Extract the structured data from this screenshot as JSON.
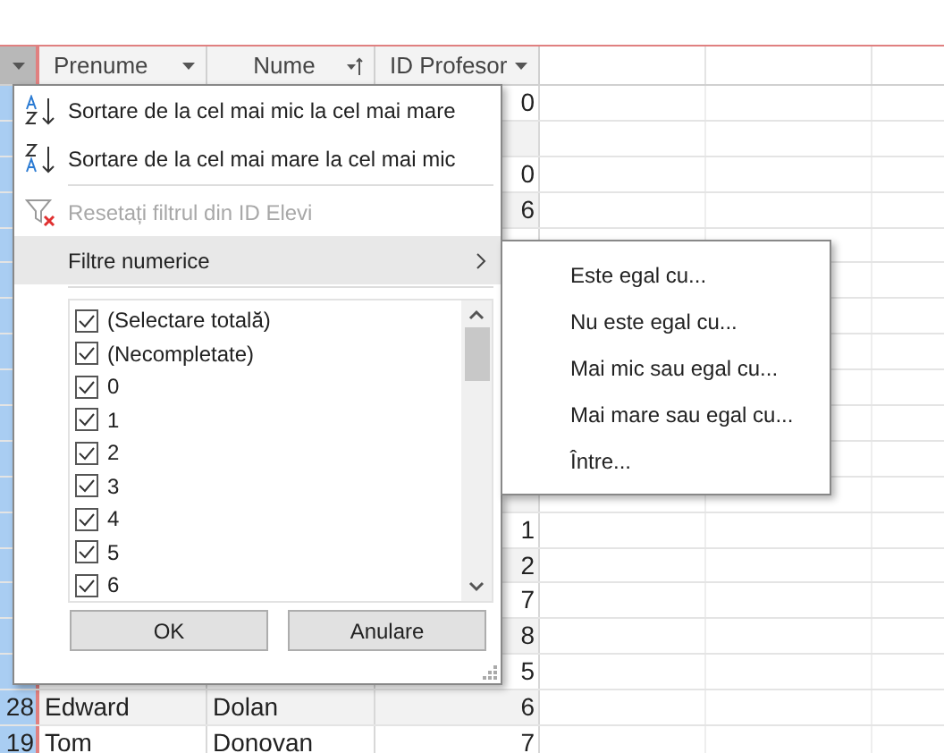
{
  "table": {
    "selector_column": {
      "selected": true
    },
    "columns": [
      {
        "label": "Prenume",
        "sorted": false
      },
      {
        "label": "Nume",
        "sorted": true
      },
      {
        "label": "ID Profesor",
        "sorted": false
      }
    ],
    "rows": [
      {
        "id_profesor": "0"
      },
      {},
      {
        "id_profesor": "0"
      },
      {
        "id_profesor": "6"
      },
      {},
      {},
      {},
      {},
      {},
      {},
      {},
      {},
      {
        "id_profesor": "1"
      },
      {
        "id_profesor": "2"
      },
      {
        "id_profesor": "7"
      },
      {
        "id_profesor": "8"
      },
      {
        "id_profesor": "5"
      },
      {
        "id": "28",
        "prenume": "Edward",
        "nume": "Dolan",
        "id_profesor": "6"
      },
      {
        "id": "19",
        "prenume": "Tom",
        "nume": "Donovan",
        "id_profesor": "7"
      }
    ]
  },
  "filter_menu": {
    "items": [
      {
        "kind": "sort-asc",
        "label": "Sortare de la cel mai mic la cel mai mare",
        "disabled": false
      },
      {
        "kind": "sort-desc",
        "label": "Sortare de la cel mai mare la cel mai mic",
        "disabled": false
      },
      {
        "kind": "clear-filter",
        "label": "Resetați filtrul din ID Elevi",
        "disabled": true
      },
      {
        "kind": "submenu",
        "label": "Filtre numerice",
        "expanded": true
      }
    ],
    "values": [
      {
        "label": "(Selectare totală)",
        "checked": true
      },
      {
        "label": "(Necompletate)",
        "checked": true
      },
      {
        "label": "0",
        "checked": true
      },
      {
        "label": "1",
        "checked": true
      },
      {
        "label": "2",
        "checked": true
      },
      {
        "label": "3",
        "checked": true
      },
      {
        "label": "4",
        "checked": true
      },
      {
        "label": "5",
        "checked": true
      },
      {
        "label": "6",
        "checked": true
      }
    ],
    "buttons": [
      "OK",
      "Anulare"
    ]
  },
  "submenu": {
    "items": [
      "Este egal cu...",
      "Nu este egal cu...",
      "Mai mic sau egal cu...",
      "Mai mare sau egal cu...",
      "Între..."
    ]
  }
}
